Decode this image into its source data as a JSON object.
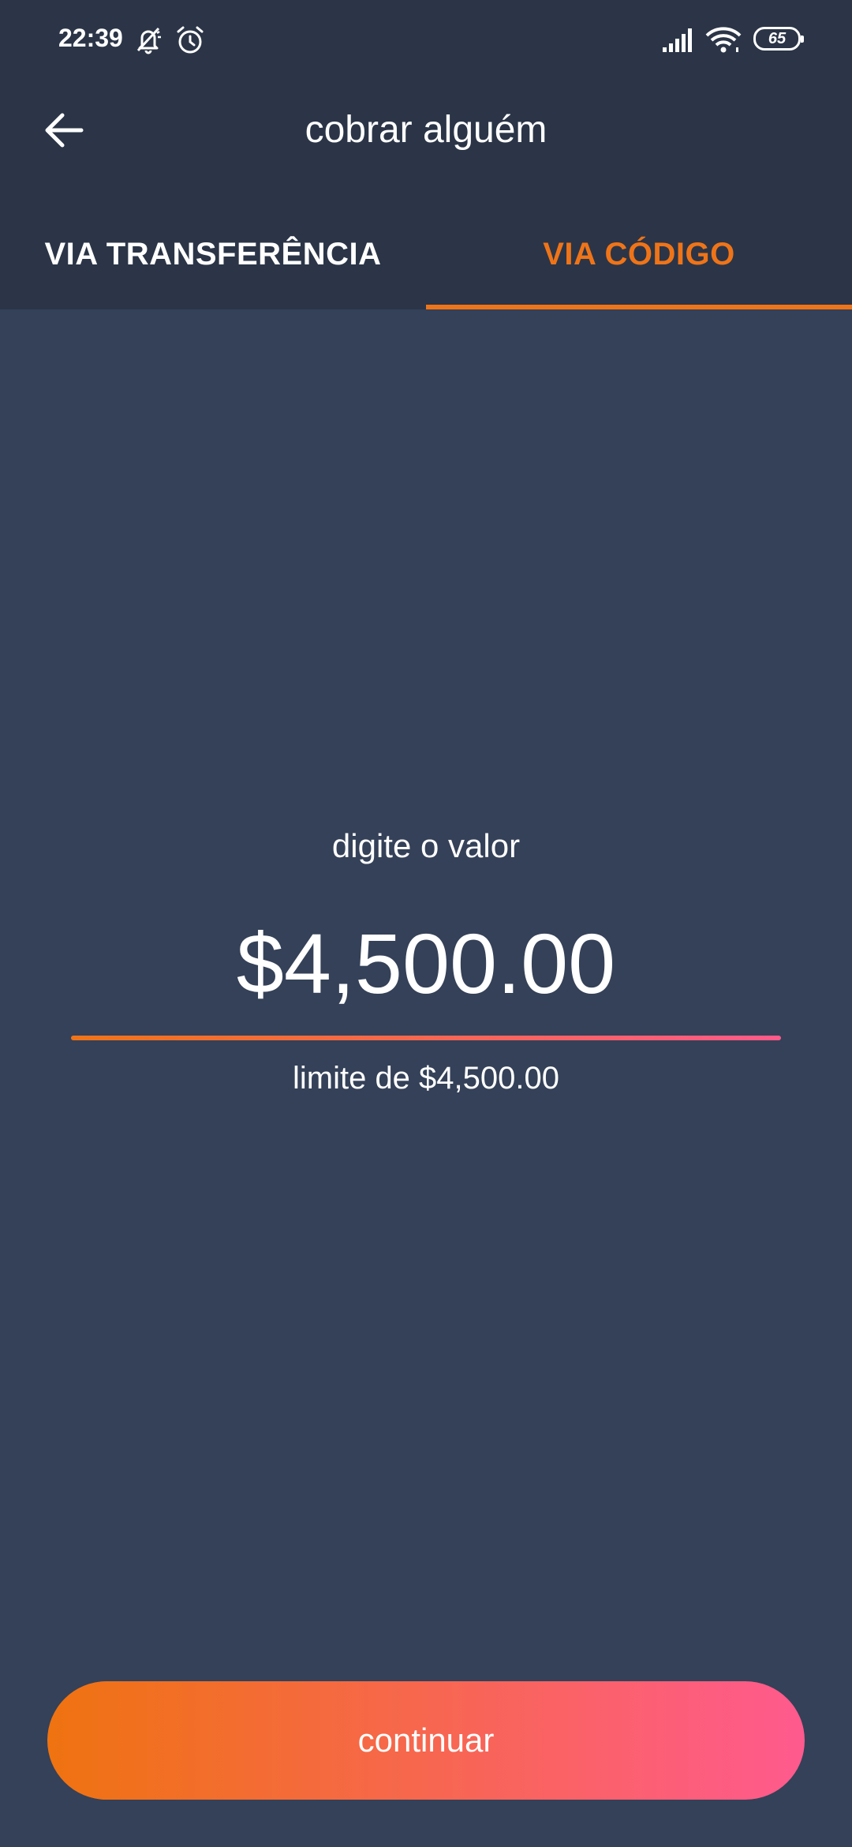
{
  "status_bar": {
    "time": "22:39",
    "battery": "65",
    "icons": [
      "mute-bell-icon",
      "alarm-icon",
      "signal-icon",
      "wifi-icon",
      "battery-icon"
    ]
  },
  "app_bar": {
    "title": "cobrar alguém",
    "back_icon": "arrow-left-icon"
  },
  "tabs": [
    {
      "label": "VIA TRANSFERÊNCIA",
      "active": false
    },
    {
      "label": "VIA CÓDIGO",
      "active": true
    }
  ],
  "main": {
    "prompt": "digite o valor",
    "amount": "$4,500.00",
    "limit": "limite de $4,500.00"
  },
  "footer": {
    "continue_label": "continuar"
  },
  "colors": {
    "background": "#344158",
    "header": "#2b3547",
    "accent": "#ef7418",
    "gradient_end": "#ff5a8a"
  }
}
